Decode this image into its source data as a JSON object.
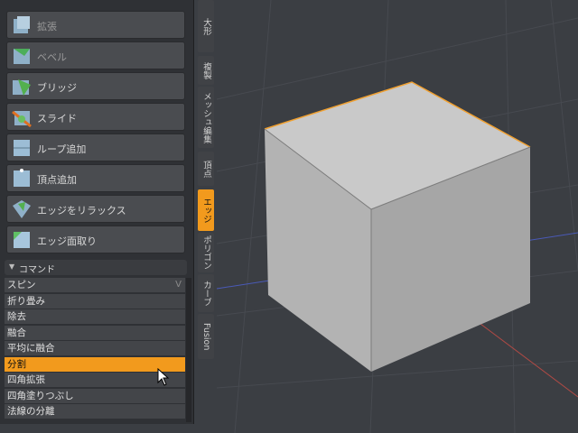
{
  "tools": [
    {
      "label": "拡張",
      "faded": true
    },
    {
      "label": "ベベル",
      "faded": true
    },
    {
      "label": "ブリッジ"
    },
    {
      "label": "スライド"
    },
    {
      "label": "ループ追加"
    },
    {
      "label": "頂点追加"
    },
    {
      "label": "エッジをリラックス"
    },
    {
      "label": "エッジ面取り"
    }
  ],
  "commands": {
    "header": "コマンド",
    "items": [
      {
        "label": "スピン",
        "shortcut": "V"
      },
      {
        "label": "折り畳み"
      },
      {
        "label": "除去"
      },
      {
        "label": "融合"
      },
      {
        "label": "平均に融合"
      },
      {
        "label": "分割",
        "active": true
      },
      {
        "label": "四角拡張"
      },
      {
        "label": "四角塗りつぶし"
      },
      {
        "label": "法線の分離"
      }
    ]
  },
  "tabs": [
    {
      "label": "大形"
    },
    {
      "label": "複製"
    },
    {
      "label": "メッシュ編集"
    },
    {
      "label": "頂点"
    },
    {
      "label": "エッジ",
      "active": true
    },
    {
      "label": "ポリゴン"
    },
    {
      "label": "カーブ"
    },
    {
      "label": "Fusion"
    }
  ],
  "colors": {
    "accent": "#f29a1d",
    "selected_edge": "#f0a030",
    "axis_x": "#b04a44",
    "axis_z": "#4a5ab8"
  }
}
